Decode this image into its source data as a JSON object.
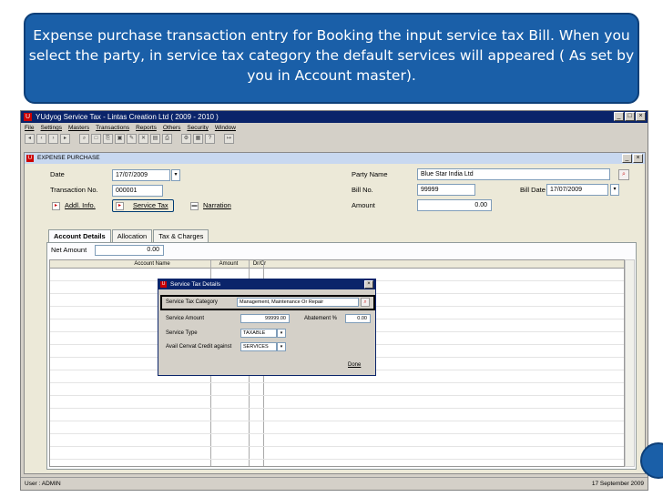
{
  "banner": {
    "text": "Expense purchase transaction entry for Booking the input service tax Bill. When you select the party, in service tax category the default services will appeared ( As set by you in Account master)."
  },
  "app": {
    "title": "YUdyog Service Tax - Lintas Creation Ltd ( 2009 - 2010 )",
    "menu": [
      "File",
      "Settings",
      "Masters",
      "Transactions",
      "Reports",
      "Others",
      "Security",
      "Window"
    ],
    "status_user": "User : ADMIN",
    "status_date": "17 September 2009"
  },
  "child": {
    "title": "EXPENSE PURCHASE"
  },
  "form": {
    "date_label": "Date",
    "date_value": "17/07/2009",
    "transaction_label": "Transaction No.",
    "transaction_value": "000001",
    "addl_info_label": "Addl. Info.",
    "service_tax_label": "Service Tax",
    "narration_label": "Narration",
    "party_label": "Party Name",
    "party_value": "Blue Star India Ltd",
    "bill_no_label": "Bill No.",
    "bill_no_value": "99999",
    "bill_date_label": "Bill Date",
    "bill_date_value": "17/07/2009",
    "amount_label": "Amount",
    "amount_value": "0.00"
  },
  "tabs": [
    {
      "label": "Account Details",
      "active": true
    },
    {
      "label": "Allocation",
      "active": false
    },
    {
      "label": "Tax & Charges",
      "active": false
    }
  ],
  "account": {
    "net_amount_label": "Net Amount",
    "net_amount_value": "0.00",
    "columns": [
      "Account Name",
      "Amount",
      "Dr/Cr"
    ]
  },
  "dialog": {
    "title": "Service Tax Details",
    "category_label": "Service Tax Category",
    "category_value": "Management, Maintenance Or Repair",
    "amount_label": "Service Amount",
    "amount_value": "99999.00",
    "abatement_label": "Abatement %",
    "abatement_value": "0.00",
    "type_label": "Service Type",
    "type_value": "TAXABLE",
    "cenvat_label": "Avail Cenvat Credit against",
    "cenvat_value": "SERVICES",
    "done_label": "Done"
  },
  "colors": {
    "banner": "#1a5fa8",
    "titlebar": "#0a246a",
    "window": "#d4d0c8"
  }
}
